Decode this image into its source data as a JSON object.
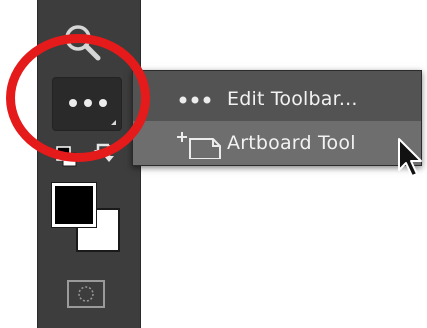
{
  "toolbar": {
    "tools": [
      {
        "icon": "zoom-icon"
      },
      {
        "icon": "ellipsis-icon",
        "role": "edit-toolbar"
      }
    ],
    "colors": {
      "foreground": "#000000",
      "background": "#ffffff"
    }
  },
  "flyout_menu": {
    "items": [
      {
        "label": "Edit Toolbar...",
        "icon": "ellipsis-icon"
      },
      {
        "label": "Artboard Tool",
        "icon": "artboard-icon",
        "highlighted": true
      }
    ]
  },
  "colors": {
    "toolbar_bg": "#3d3d3d",
    "menu_bg": "#535353",
    "menu_highlight": "#6e6e6e",
    "annotation_red": "#e51a1a"
  }
}
